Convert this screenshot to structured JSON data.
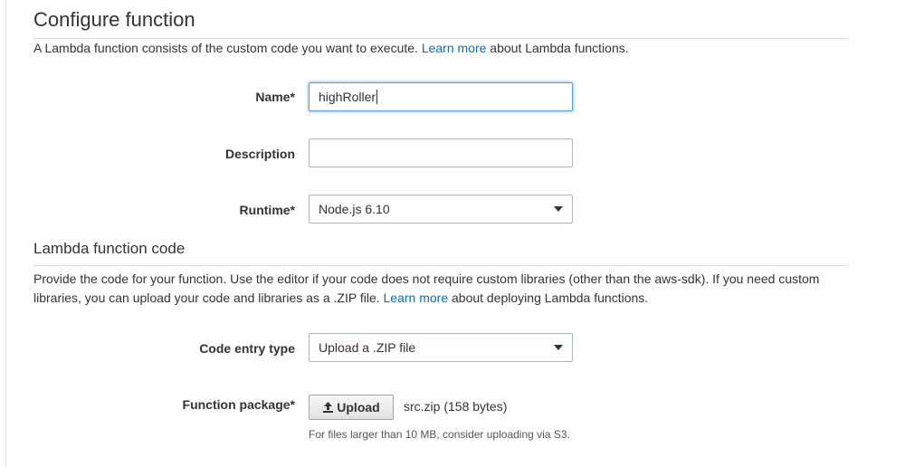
{
  "configure": {
    "title": "Configure function",
    "description_before": "A Lambda function consists of the custom code you want to execute. ",
    "description_link": "Learn more",
    "description_after": " about Lambda functions.",
    "name_label": "Name*",
    "name_value": "highRoller",
    "description_label": "Description",
    "description_value": "",
    "runtime_label": "Runtime*",
    "runtime_value": "Node.js 6.10"
  },
  "code": {
    "title": "Lambda function code",
    "description_before": "Provide the code for your function. Use the editor if your code does not require custom libraries (other than the aws-sdk). If you need custom libraries, you can upload your code and libraries as a .ZIP file. ",
    "description_link": "Learn more",
    "description_after": " about deploying Lambda functions.",
    "entry_type_label": "Code entry type",
    "entry_type_value": "Upload a .ZIP file",
    "package_label": "Function package*",
    "upload_button_label": "Upload",
    "file_info": "src.zip (158 bytes)",
    "help_text": "For files larger than 10 MB, consider uploading via S3."
  },
  "icons": {
    "upload": "upload-icon",
    "dropdown": "chevron-down-icon"
  },
  "colors": {
    "link": "#0073bb",
    "focus_border": "#5b9dd9",
    "text": "#333333"
  }
}
